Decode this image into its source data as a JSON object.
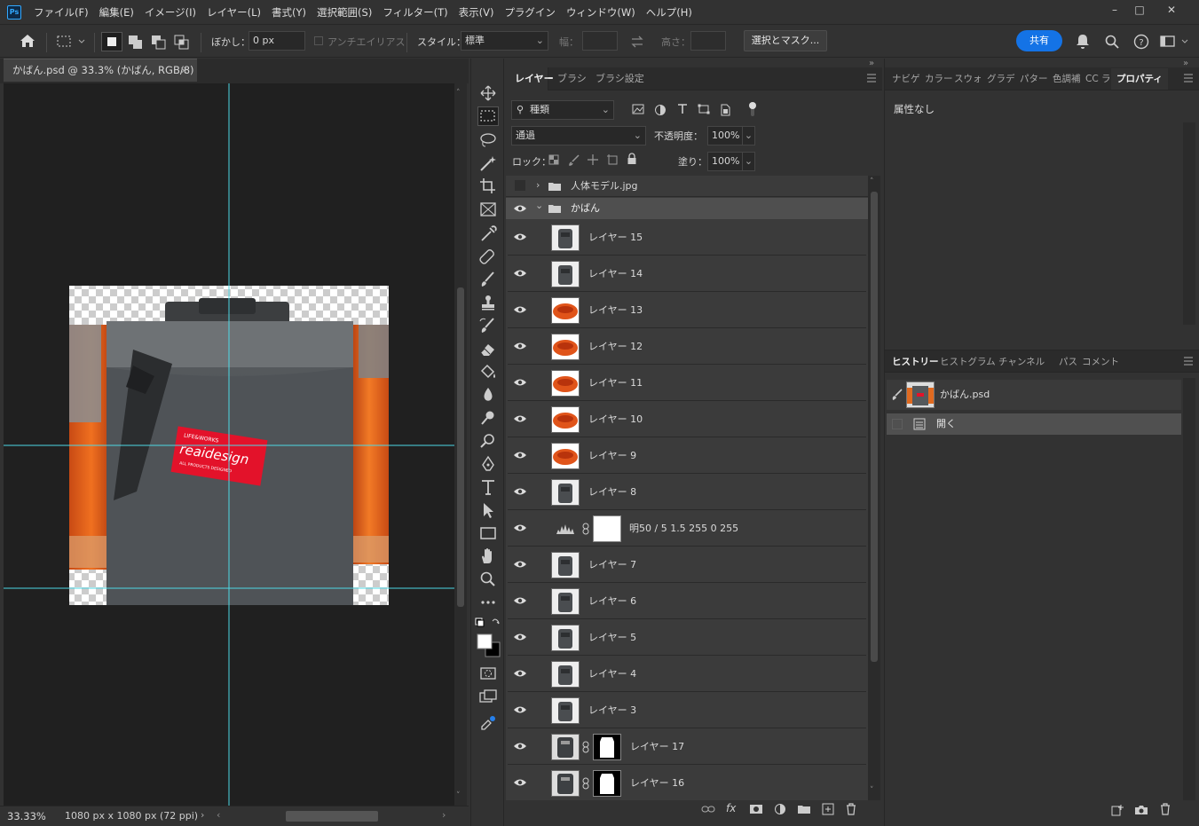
{
  "menubar": {
    "logo": "Ps",
    "items": [
      "ファイル(F)",
      "編集(E)",
      "イメージ(I)",
      "レイヤー(L)",
      "書式(Y)",
      "選択範囲(S)",
      "フィルター(T)",
      "表示(V)",
      "プラグイン",
      "ウィンドウ(W)",
      "ヘルプ(H)"
    ]
  },
  "options": {
    "feather_label": "ぼかし：",
    "feather_value": "0 px",
    "antialias_label": "アンチエイリアス",
    "style_label": "スタイル：",
    "style_value": "標準",
    "width_label": "幅：",
    "height_label": "高さ：",
    "select_mask_button": "選択とマスク...",
    "share_button": "共有"
  },
  "document": {
    "tab_title": "かばん.psd @ 33.3% (かばん, RGB/8)",
    "zoom": "33.33%",
    "doc_info": "1080 px x 1080 px (72 ppi)",
    "patch_line1": "LIFE&WORKS",
    "patch_brand": "reaidesign",
    "patch_line3": "ALL PRODUCTS DESIGNED"
  },
  "layers_panel": {
    "tabs": [
      "レイヤー",
      "ブラシ",
      "ブラシ設定"
    ],
    "filter_kind": "種類",
    "blend_mode": "通過",
    "opacity_label": "不透明度：",
    "opacity_value": "100%",
    "lock_label": "ロック：",
    "fill_label": "塗り：",
    "fill_value": "100%",
    "groups": [
      {
        "name": "人体モデル.jpg"
      },
      {
        "name": "かばん"
      }
    ],
    "layers": [
      {
        "name": "レイヤー 15",
        "kind": "bag"
      },
      {
        "name": "レイヤー 14",
        "kind": "bag"
      },
      {
        "name": "レイヤー 13",
        "kind": "orange"
      },
      {
        "name": "レイヤー 12",
        "kind": "orange"
      },
      {
        "name": "レイヤー 11",
        "kind": "orange"
      },
      {
        "name": "レイヤー 10",
        "kind": "orange"
      },
      {
        "name": "レイヤー 9",
        "kind": "orange"
      },
      {
        "name": "レイヤー 8",
        "kind": "bag"
      },
      {
        "name": "明50 / 5 1.5 255 0 255",
        "kind": "adjust"
      },
      {
        "name": "レイヤー 7",
        "kind": "bag"
      },
      {
        "name": "レイヤー 6",
        "kind": "bag"
      },
      {
        "name": "レイヤー 5",
        "kind": "bag"
      },
      {
        "name": "レイヤー 4",
        "kind": "bag"
      },
      {
        "name": "レイヤー 3",
        "kind": "bag"
      },
      {
        "name": "レイヤー 17",
        "kind": "mask"
      },
      {
        "name": "レイヤー 16",
        "kind": "mask"
      }
    ]
  },
  "right_panel": {
    "top_tabs": [
      "ナビゲ",
      "カラー",
      "スウォ",
      "グラデ",
      "パター",
      "色調補",
      "CC ラ",
      "プロパティ"
    ],
    "properties_text": "属性なし",
    "bottom_tabs": [
      "ヒストリー",
      "ヒストグラム",
      "チャンネル",
      "パス",
      "コメント"
    ],
    "history_snapshot": "かばん.psd",
    "history_items": [
      "開く"
    ]
  },
  "colors": {
    "accent": "#1473e6",
    "guide": "#4dd9e6",
    "panel": "#323232",
    "canvas_bg": "#202020"
  }
}
